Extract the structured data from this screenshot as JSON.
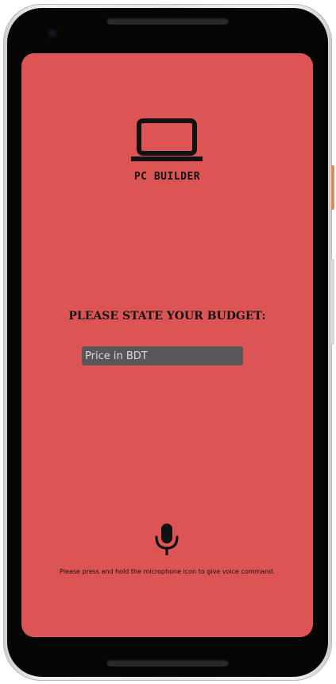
{
  "app": {
    "logo_text": "PC BUILDER",
    "logo_icon": "laptop-icon"
  },
  "budget": {
    "label": "PLEASE STATE YOUR BUDGET:",
    "input_placeholder": "Price in BDT",
    "input_value": ""
  },
  "voice": {
    "icon": "microphone-icon",
    "hint": "Please press and hold the microphone icon to give voice command."
  },
  "colors": {
    "screen_background": "#dc5554",
    "input_background": "#5a5657",
    "text": "#111111",
    "device_frame": "#050505"
  }
}
